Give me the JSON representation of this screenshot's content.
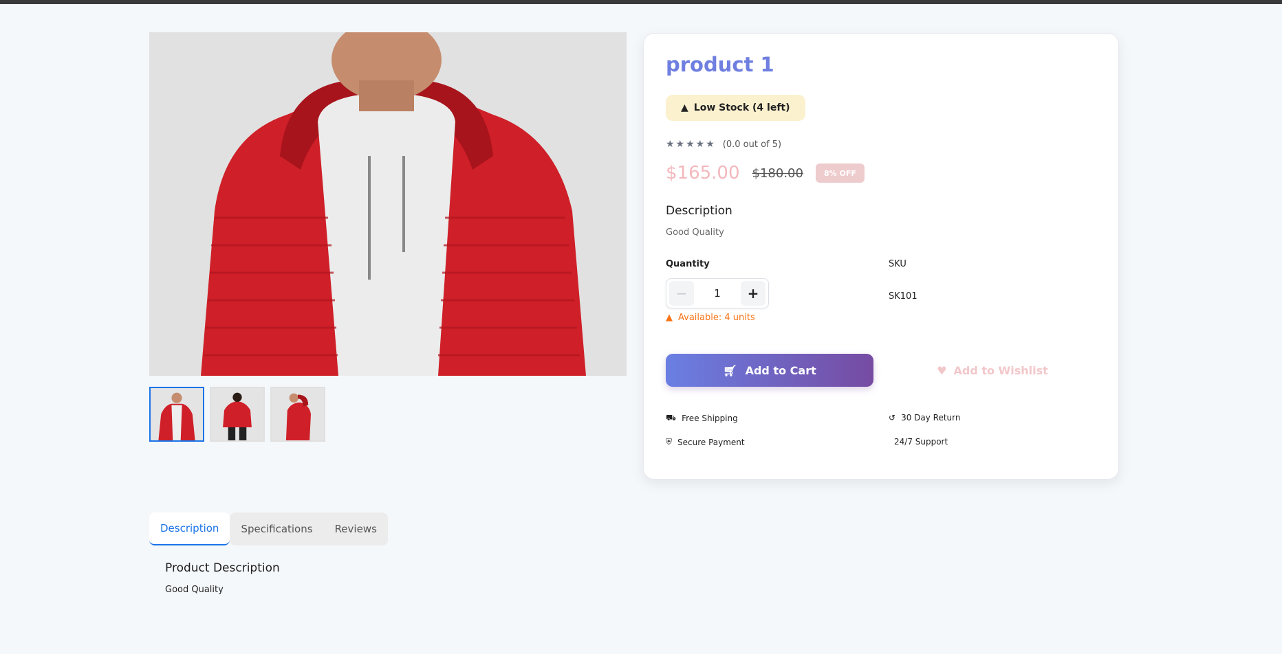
{
  "product": {
    "title": "product 1",
    "stock_badge": "Low Stock (4 left)",
    "rating_text": "(0.0 out of 5)",
    "rating_value": 0,
    "price": "$165.00",
    "old_price": "$180.00",
    "discount": "8% OFF",
    "description_heading": "Description",
    "description_text": "Good Quality",
    "quantity_label": "Quantity",
    "quantity_value": "1",
    "available_text": "Available: 4 units",
    "sku_label": "SKU",
    "sku_value": "SK101",
    "add_to_cart_label": "Add to Cart",
    "add_to_wishlist_label": "Add to Wishlist"
  },
  "features": [
    {
      "label": "Free Shipping",
      "icon": "truck-icon"
    },
    {
      "label": "30 Day Return",
      "icon": "undo-icon"
    },
    {
      "label": "Secure Payment",
      "icon": "shield-icon"
    },
    {
      "label": "24/7 Support",
      "icon": "headset-icon"
    }
  ],
  "gallery": {
    "thumbnails": [
      {
        "alt": "front view",
        "active": true
      },
      {
        "alt": "back view",
        "active": false
      },
      {
        "alt": "side view",
        "active": false
      }
    ]
  },
  "tabs": [
    {
      "label": "Description",
      "active": true
    },
    {
      "label": "Specifications",
      "active": false
    },
    {
      "label": "Reviews",
      "active": false
    }
  ],
  "tab_content": {
    "heading": "Product Description",
    "text": "Good Quality"
  },
  "colors": {
    "accent": "#6f7fe0",
    "gradient_start": "#6a7fe3",
    "gradient_end": "#764ba2",
    "warning": "#f97316",
    "tab_active": "#1a73e8"
  }
}
